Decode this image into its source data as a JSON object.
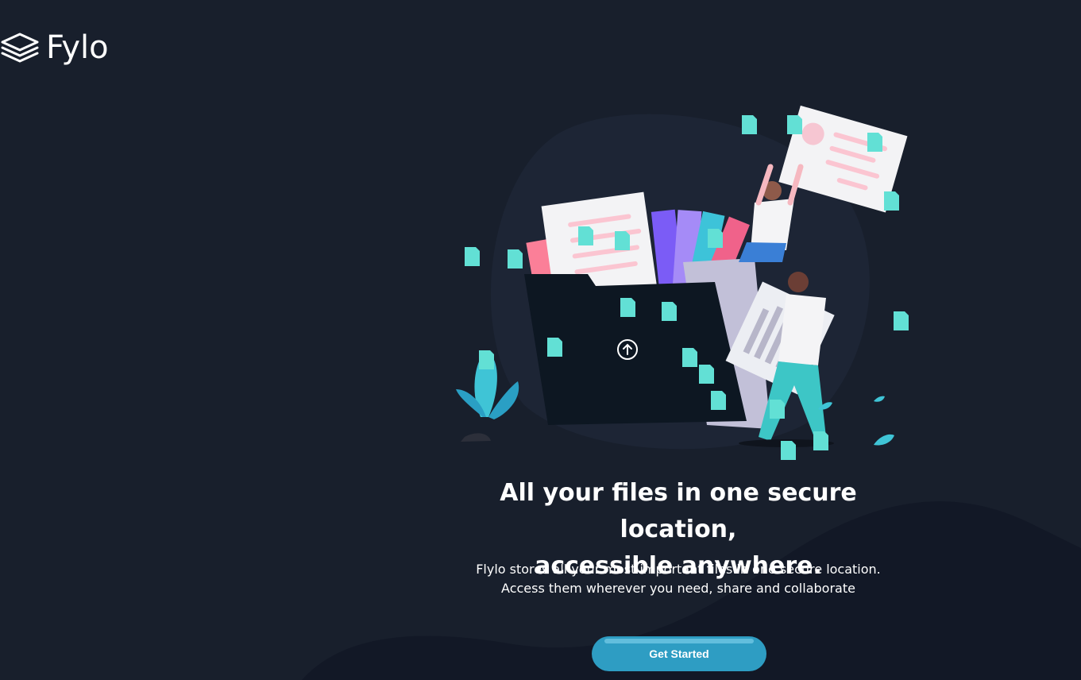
{
  "brand": {
    "name": "Fylo",
    "logo_icon": "stacked-layers-icon"
  },
  "hero": {
    "illustration": "people-uploading-files-illustration",
    "upload_icon": "upload-arrow-icon",
    "file_icon": "document-icon"
  },
  "intro": {
    "headline_line1": "All your files in one secure location,",
    "headline_line2": "accessible anywhere.",
    "description_line1": "Flylo stores all your most important files in one secure location.",
    "description_line2": "Access them wherever you need, share and collaborate"
  },
  "cta": {
    "label": "Get Started"
  },
  "colors": {
    "background": "#181f2c",
    "curve": "#121826",
    "accent": "#2e9dc3",
    "file_icon": "#62e0d5"
  }
}
